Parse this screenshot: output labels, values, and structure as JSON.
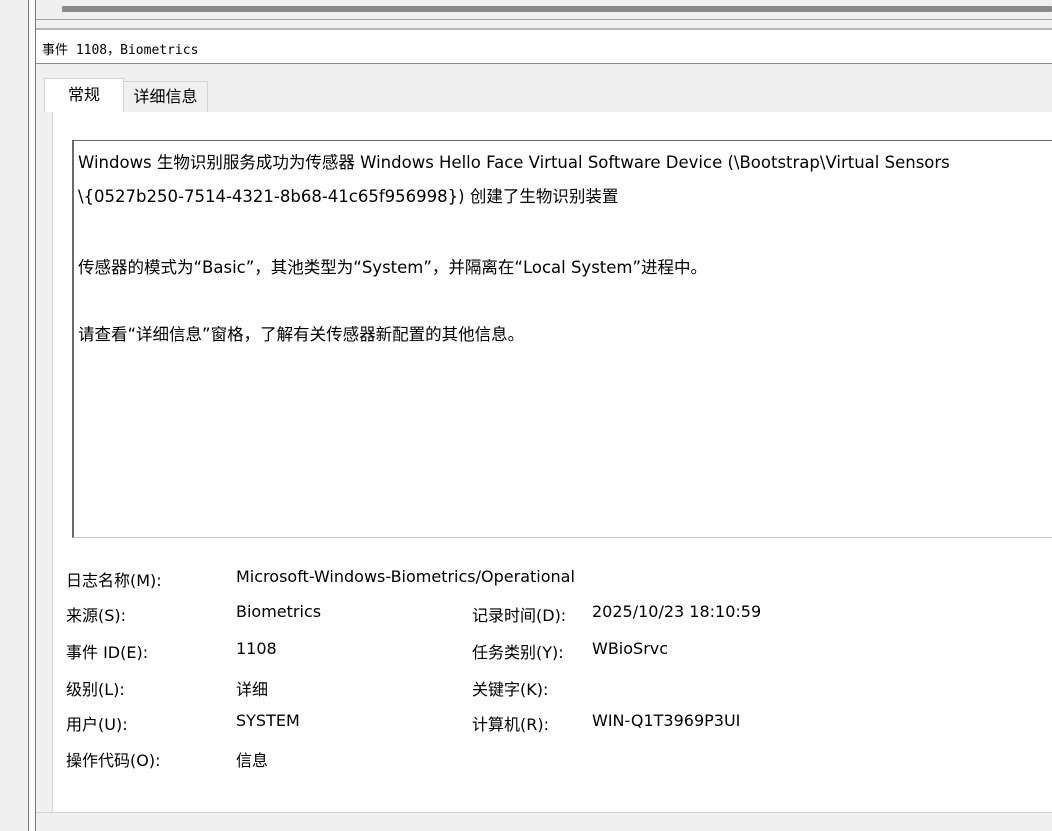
{
  "header": {
    "title": "事件 1108，Biometrics"
  },
  "tabs": [
    {
      "label": "常规"
    },
    {
      "label": "详细信息"
    }
  ],
  "description": {
    "line1": "Windows 生物识别服务成功为传感器 Windows Hello Face Virtual Software Device (\\Bootstrap\\Virtual Sensors",
    "line2": "\\{0527b250-7514-4321-8b68-41c65f956998}) 创建了生物识别装置",
    "line3": "传感器的模式为“Basic”，其池类型为“System”，并隔离在“Local System”进程中。",
    "line4": "请查看“详细信息”窗格，了解有关传感器新配置的其他信息。"
  },
  "fields": {
    "log_name": {
      "label": "日志名称(M):",
      "value": "Microsoft-Windows-Biometrics/Operational"
    },
    "source": {
      "label": "来源(S):",
      "value": "Biometrics"
    },
    "logged": {
      "label": "记录时间(D):",
      "value": "2025/10/23 18:10:59"
    },
    "event_id": {
      "label": "事件 ID(E):",
      "value": "1108"
    },
    "task_category": {
      "label": "任务类别(Y):",
      "value": "WBioSrvc"
    },
    "level": {
      "label": "级别(L):",
      "value": "详细"
    },
    "keywords": {
      "label": "关键字(K):",
      "value": ""
    },
    "user": {
      "label": "用户(U):",
      "value": "SYSTEM"
    },
    "computer": {
      "label": "计算机(R):",
      "value": "WIN-Q1T3969P3UI"
    },
    "opcode": {
      "label": "操作代码(O):",
      "value": "信息"
    }
  }
}
